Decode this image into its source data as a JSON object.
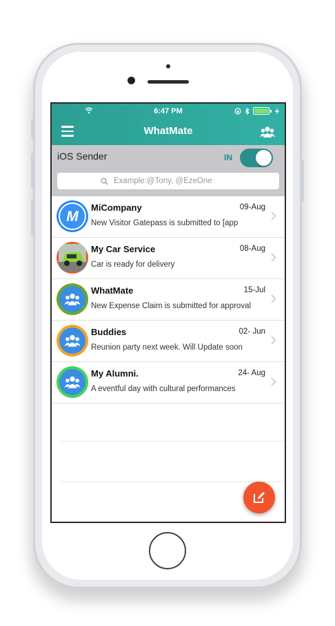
{
  "status_bar": {
    "time": "6:47 PM"
  },
  "nav": {
    "title": "WhatMate",
    "left_icon": "menu-icon",
    "right_icon": "group-icon"
  },
  "sender": {
    "label": "iOS Sender",
    "toggle_label": "IN",
    "toggle_on": true,
    "search_placeholder": "Example:@Tony, @EzeOne"
  },
  "chats": [
    {
      "name": "MiCompany",
      "date": "09-Aug",
      "message": "New Visitor Gatepass is submitted to [app",
      "avatar": "company-logo-icon",
      "ring_color": "#2f86e8"
    },
    {
      "name": "My Car Service",
      "date": "08-Aug",
      "message": "Car is ready for delivery",
      "avatar": "car-photo",
      "ring_color": "#e8592a"
    },
    {
      "name": "WhatMate",
      "date": "15-Jul",
      "message": "New Expense Claim is submitted for approval",
      "avatar": "group-icon",
      "ring_color": "#6aa632"
    },
    {
      "name": "Buddies",
      "date": "02- Jun",
      "message": "Reunion party next week. Will Update soon",
      "avatar": "group-icon",
      "ring_color": "#f0a330"
    },
    {
      "name": "My Alumni.",
      "date": "24- Aug",
      "message": "A eventful day with cultural performances",
      "avatar": "group-icon",
      "ring_color": "#45d45a"
    }
  ],
  "colors": {
    "accent": "#2fa79b",
    "fab": "#f2542d",
    "toggle": "#2a8f8a"
  }
}
